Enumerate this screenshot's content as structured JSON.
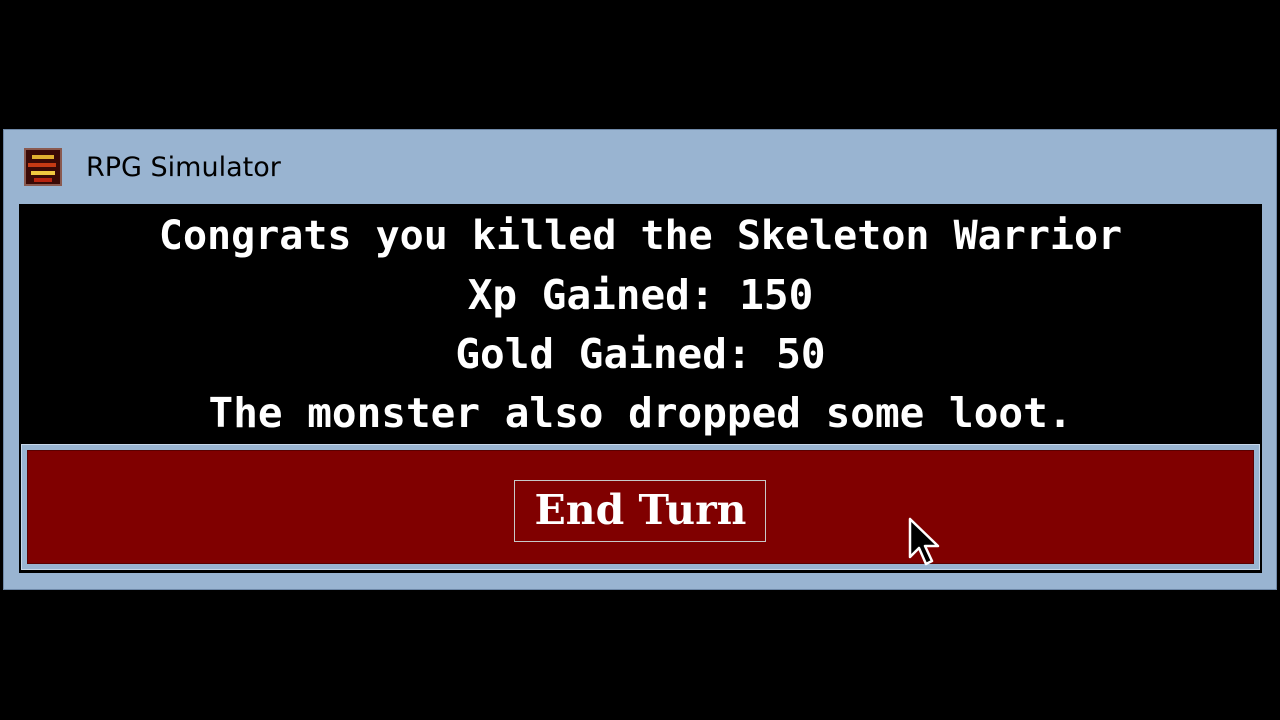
{
  "window": {
    "title": "RPG Simulator",
    "icon": "rpg-app-icon"
  },
  "messages": {
    "kill": "Congrats you killed the Skeleton Warrior",
    "xp": "Xp Gained: 150",
    "gold": "Gold Gained: 50",
    "loot": "The monster also dropped some loot."
  },
  "actions": {
    "end_turn": "End Turn"
  },
  "colors": {
    "window_frame": "#99b4d1",
    "client_background": "#000000",
    "message_text": "#ffffff",
    "button_background": "#800000"
  }
}
